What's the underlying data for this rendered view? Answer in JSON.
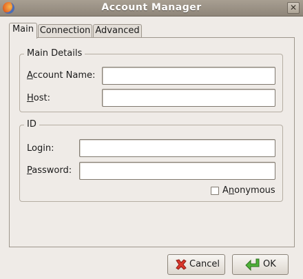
{
  "window": {
    "title": "Account Manager",
    "close_glyph": "✕",
    "app_icon": "firefox-icon"
  },
  "tabs": [
    {
      "label": "Main",
      "active": true
    },
    {
      "label": "Connection",
      "active": false
    },
    {
      "label": "Advanced",
      "active": false
    }
  ],
  "main_details": {
    "legend": "Main Details",
    "account_name_label_mnemonic": "A",
    "account_name_label_rest": "ccount Name:",
    "account_name_value": "",
    "host_label_mnemonic": "H",
    "host_label_rest": "ost:",
    "host_value": ""
  },
  "id_group": {
    "legend": "ID",
    "login_label": "Login:",
    "login_value": "",
    "password_label_mnemonic": "P",
    "password_label_rest": "assword:",
    "password_value": "",
    "anonymous_label_pre": "A",
    "anonymous_label_mnemonic": "n",
    "anonymous_label_rest": "onymous",
    "anonymous_checked": false
  },
  "buttons": {
    "cancel_label": "Cancel",
    "cancel_icon": "red-x-icon",
    "ok_label": "OK",
    "ok_icon": "green-return-arrow-icon"
  },
  "colors": {
    "window_bg": "#efebe7",
    "titlebar": "#9a9185",
    "cancel_icon": "#d9362b",
    "ok_icon": "#3f9a2e"
  }
}
